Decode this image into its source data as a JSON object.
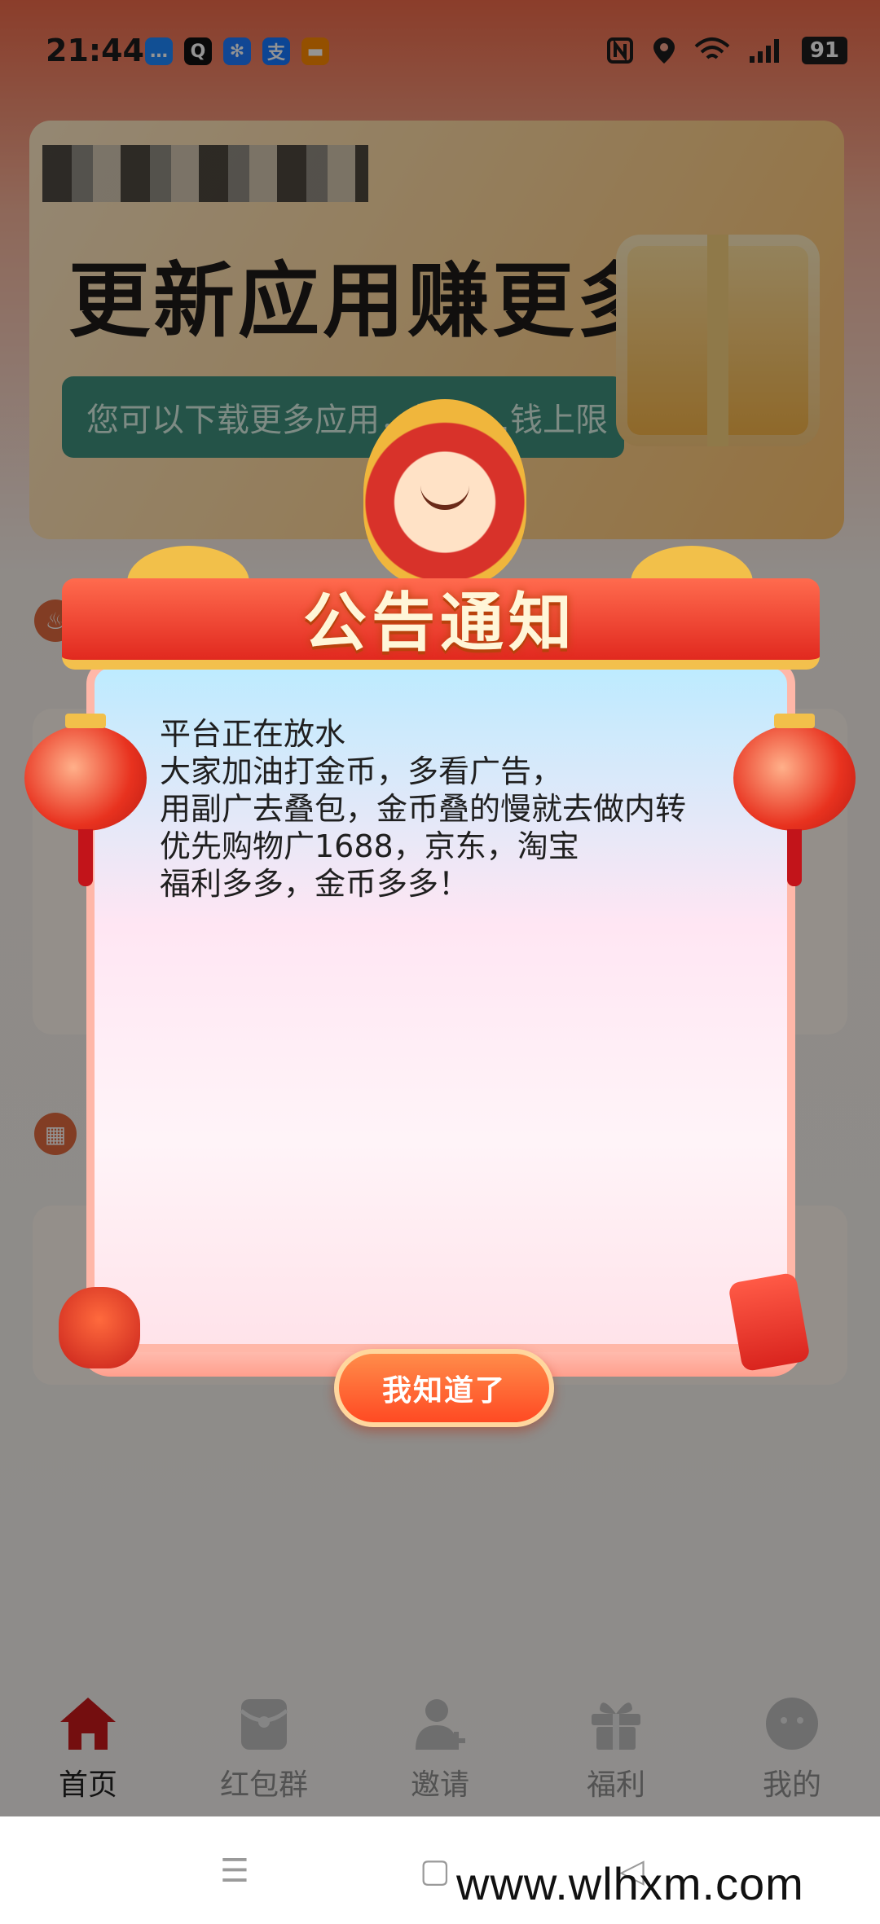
{
  "status_bar": {
    "time": "21:44",
    "notification_icons": [
      {
        "icon": "message-icon",
        "color": "#1e88ff",
        "glyph": "…"
      },
      {
        "icon": "qq-icon",
        "color": "#111111",
        "glyph": "Q"
      },
      {
        "icon": "pinwheel-icon",
        "color": "#1e7bff",
        "glyph": "✻"
      },
      {
        "icon": "alipay-icon",
        "color": "#1677ff",
        "glyph": "支"
      },
      {
        "icon": "wallet-icon",
        "color": "#ff8a00",
        "glyph": "▬"
      }
    ],
    "system_icons": [
      "nfc-icon",
      "location-icon",
      "wifi-icon",
      "5g-signal-icon"
    ],
    "battery": "91"
  },
  "banner": {
    "title": "更新应用赚更多",
    "subtitle": "您可以下载更多应用，增加…钱上限"
  },
  "dialog": {
    "title": "公告通知",
    "message_lines": [
      "平台正在放水",
      "大家加油打金币，多看广告，",
      "用副广去叠包，金币叠的慢就去做内转",
      "优先购物广1688，京东，淘宝",
      "福利多多，金币多多！"
    ],
    "confirm_label": "我知道了"
  },
  "tabbar": {
    "items": [
      {
        "label": "首页",
        "icon": "home-icon",
        "active": true
      },
      {
        "label": "红包群",
        "icon": "red-envelope-icon",
        "active": false
      },
      {
        "label": "邀请",
        "icon": "invite-user-icon",
        "active": false
      },
      {
        "label": "福利",
        "icon": "gift-icon",
        "active": false
      },
      {
        "label": "我的",
        "icon": "profile-icon",
        "active": false
      }
    ]
  },
  "navbar": {
    "menu_glyph": "☰",
    "home_glyph": "▢",
    "back_glyph": "◁"
  },
  "watermark": "www.wlhxm.com",
  "colors": {
    "accent": "#e02a1e",
    "button_gradient_start": "#ff8c4a",
    "button_gradient_end": "#ff4a23",
    "tab_active": "#c8191b",
    "tab_inactive": "#9a9a9a"
  }
}
